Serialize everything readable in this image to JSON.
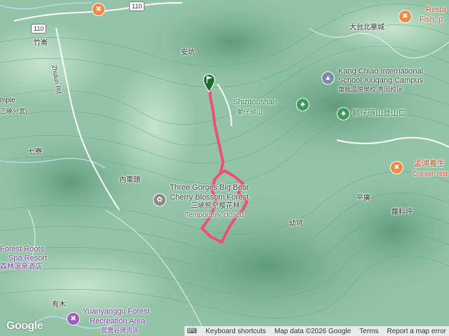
{
  "map": {
    "road_shields": [
      "110",
      "110"
    ],
    "labels": {
      "zhunan_road": "Zhulun Rd",
      "zhulun": "竹崙",
      "ankeng": "安坑",
      "temple_en": "mple",
      "temple_zh": "三峽分宮)",
      "qiliao": "七寮",
      "neichetou": "內車頭",
      "youkeng": "幼坑",
      "pingguang": "平廣",
      "luoliaoping": "蘿料坪",
      "youmu": "有木",
      "dataibeihuacheng": "大台北華城"
    },
    "pois": {
      "restaurant_top": "Resta",
      "restaurant_top2": "Fish, p",
      "kang_chiao_1": "Kang Chiao International",
      "kang_chiao_2": "School Xiuqang Campus",
      "kang_chiao_zh": "康橋國際學校 秀岡校區",
      "shizitoushan_en": "Shizitoushan",
      "shizitoushan_zh": "獅仔頭山",
      "trailhead_zh": "獅仔頭山登山口",
      "forest_1": "Three Gorges Big Bear",
      "forest_2": "Cherry Blossom Forest",
      "forest_zh": "三峽熊空樱花林",
      "forest_status": "Temporarily closed",
      "chicken_zh": "孟鴻養生",
      "chicken_en": "Chicken rest",
      "resort_1": "Forest Roots",
      "resort_2": "Spa Resort",
      "resort_zh": "森林溫泉酒店",
      "yuanyanggu_1": "Yuanyanggu Forest",
      "yuanyanggu_2": "Recreation Area",
      "yuanyanggu_zh": "鴛鴦谷烤肉區"
    },
    "track_color": "#f0506e",
    "icons": [
      "restaurant-icon",
      "school-icon",
      "park-icon",
      "flower-icon",
      "start-flag-icon"
    ]
  },
  "footer": {
    "logo": "Google",
    "keyboard_shortcuts": "Keyboard shortcuts",
    "map_data": "Map data ©2026 Google",
    "terms": "Terms",
    "report": "Report a map error"
  }
}
